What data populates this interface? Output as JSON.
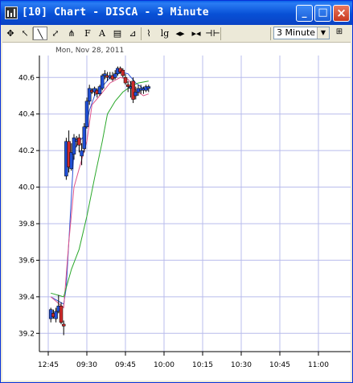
{
  "window": {
    "title": "[10] Chart - DISCA - 3 Minute",
    "minimize_label": "_",
    "maximize_label": "□",
    "close_label": "×"
  },
  "toolbar": {
    "tools": [
      {
        "name": "crosshair-tool",
        "glyph": "✥"
      },
      {
        "name": "pointer-tool",
        "glyph": "↖"
      },
      {
        "name": "trendline-tool",
        "glyph": "╲",
        "active": true
      },
      {
        "name": "angled-line-tool",
        "glyph": "⤢"
      },
      {
        "name": "pitchfork-tool",
        "glyph": "⋔"
      },
      {
        "name": "fibonacci-tool",
        "glyph": "F"
      },
      {
        "name": "text-tool",
        "glyph": "A"
      },
      {
        "name": "note-tool",
        "glyph": "▤"
      },
      {
        "name": "chart-style-tool",
        "glyph": "⊿"
      },
      {
        "name": "indicator-tool",
        "glyph": "⌇"
      },
      {
        "name": "log-scale-tool",
        "glyph": "lg"
      },
      {
        "name": "zoom-in-tool",
        "glyph": "◂▸"
      },
      {
        "name": "zoom-out-tool",
        "glyph": "▸◂"
      },
      {
        "name": "scroll-tool",
        "glyph": "⊣⊢"
      }
    ],
    "interval_value": "3 Minute",
    "interval_arrow": "▼",
    "extra_glyph": "⊞"
  },
  "chart_data": {
    "type": "candlestick",
    "symbol": "DISCA",
    "date_label": "Mon, Nov 28, 2011",
    "ylim": [
      39.1,
      40.72
    ],
    "y_ticks": [
      39.2,
      39.4,
      39.6,
      39.8,
      40.0,
      40.2,
      40.4,
      40.6
    ],
    "y_tick_labels": [
      "39.2",
      "39.4",
      "39.6",
      "39.8",
      "40.0",
      "40.2",
      "40.4",
      "40.6"
    ],
    "x_ticks": [
      0,
      15,
      30,
      45,
      60,
      75,
      90,
      105
    ],
    "x_tick_labels": [
      "12:45",
      "09:30",
      "09:45",
      "10:00",
      "10:15",
      "10:30",
      "10:45",
      "11:00"
    ],
    "grid": true,
    "up_color": "#1f4fd6",
    "down_color": "#cc2a2a",
    "grid_color": "#b8bcec",
    "candles": [
      {
        "t": 1,
        "o": 39.28,
        "h": 39.34,
        "l": 39.26,
        "c": 39.33
      },
      {
        "t": 2,
        "o": 39.31,
        "h": 39.33,
        "l": 39.28,
        "c": 39.29
      },
      {
        "t": 3,
        "o": 39.28,
        "h": 39.34,
        "l": 39.26,
        "c": 39.32
      },
      {
        "t": 4,
        "o": 39.32,
        "h": 39.41,
        "l": 39.31,
        "c": 39.35
      },
      {
        "t": 5,
        "o": 39.35,
        "h": 39.37,
        "l": 39.25,
        "c": 39.26
      },
      {
        "t": 6,
        "o": 39.25,
        "h": 39.27,
        "l": 39.19,
        "c": 39.24
      },
      {
        "t": 7,
        "o": 40.06,
        "h": 40.27,
        "l": 40.04,
        "c": 40.25
      },
      {
        "t": 8,
        "o": 40.25,
        "h": 40.31,
        "l": 40.08,
        "c": 40.11
      },
      {
        "t": 9,
        "o": 40.1,
        "h": 40.24,
        "l": 40.09,
        "c": 40.19
      },
      {
        "t": 10,
        "o": 40.18,
        "h": 40.29,
        "l": 40.15,
        "c": 40.27
      },
      {
        "t": 11,
        "o": 40.25,
        "h": 40.28,
        "l": 40.22,
        "c": 40.26
      },
      {
        "t": 12,
        "o": 40.27,
        "h": 40.29,
        "l": 40.19,
        "c": 40.23
      },
      {
        "t": 13,
        "o": 40.17,
        "h": 40.24,
        "l": 40.12,
        "c": 40.2
      },
      {
        "t": 14,
        "o": 40.21,
        "h": 40.35,
        "l": 40.19,
        "c": 40.33
      },
      {
        "t": 15,
        "o": 40.33,
        "h": 40.49,
        "l": 40.32,
        "c": 40.47
      },
      {
        "t": 16,
        "o": 40.47,
        "h": 40.56,
        "l": 40.45,
        "c": 40.54
      },
      {
        "t": 17,
        "o": 40.53,
        "h": 40.54,
        "l": 40.51,
        "c": 40.52
      },
      {
        "t": 18,
        "o": 40.52,
        "h": 40.55,
        "l": 40.5,
        "c": 40.54
      },
      {
        "t": 19,
        "o": 40.53,
        "h": 40.54,
        "l": 40.49,
        "c": 40.51
      },
      {
        "t": 20,
        "o": 40.51,
        "h": 40.56,
        "l": 40.5,
        "c": 40.55
      },
      {
        "t": 21,
        "o": 40.54,
        "h": 40.62,
        "l": 40.53,
        "c": 40.61
      },
      {
        "t": 22,
        "o": 40.61,
        "h": 40.64,
        "l": 40.59,
        "c": 40.62
      },
      {
        "t": 23,
        "o": 40.61,
        "h": 40.63,
        "l": 40.58,
        "c": 40.6
      },
      {
        "t": 24,
        "o": 40.6,
        "h": 40.63,
        "l": 40.59,
        "c": 40.61
      },
      {
        "t": 25,
        "o": 40.61,
        "h": 40.63,
        "l": 40.58,
        "c": 40.59
      },
      {
        "t": 26,
        "o": 40.6,
        "h": 40.64,
        "l": 40.59,
        "c": 40.62
      },
      {
        "t": 27,
        "o": 40.62,
        "h": 40.66,
        "l": 40.61,
        "c": 40.65
      },
      {
        "t": 28,
        "o": 40.65,
        "h": 40.66,
        "l": 40.62,
        "c": 40.63
      },
      {
        "t": 29,
        "o": 40.64,
        "h": 40.65,
        "l": 40.6,
        "c": 40.61
      },
      {
        "t": 30,
        "o": 40.6,
        "h": 40.62,
        "l": 40.56,
        "c": 40.57
      },
      {
        "t": 31,
        "o": 40.56,
        "h": 40.58,
        "l": 40.52,
        "c": 40.55
      },
      {
        "t": 32,
        "o": 40.54,
        "h": 40.58,
        "l": 40.49,
        "c": 40.55
      },
      {
        "t": 33,
        "o": 40.58,
        "h": 40.6,
        "l": 40.46,
        "c": 40.48
      },
      {
        "t": 34,
        "o": 40.5,
        "h": 40.55,
        "l": 40.48,
        "c": 40.52
      },
      {
        "t": 35,
        "o": 40.52,
        "h": 40.56,
        "l": 40.5,
        "c": 40.54
      },
      {
        "t": 36,
        "o": 40.53,
        "h": 40.56,
        "l": 40.51,
        "c": 40.54
      },
      {
        "t": 37,
        "o": 40.53,
        "h": 40.55,
        "l": 40.51,
        "c": 40.54
      },
      {
        "t": 38,
        "o": 40.53,
        "h": 40.56,
        "l": 40.52,
        "c": 40.55
      },
      {
        "t": 39,
        "o": 40.54,
        "h": 40.56,
        "l": 40.52,
        "c": 40.55
      }
    ],
    "series": [
      {
        "color": "#2e55d8",
        "values": [
          [
            1,
            39.4
          ],
          [
            6,
            39.36
          ],
          [
            7,
            39.45
          ],
          [
            10,
            40.2
          ],
          [
            12,
            40.25
          ],
          [
            14,
            40.28
          ],
          [
            16,
            40.42
          ],
          [
            18,
            40.5
          ],
          [
            21,
            40.55
          ],
          [
            24,
            40.6
          ],
          [
            28,
            40.63
          ],
          [
            31,
            40.62
          ],
          [
            34,
            40.57
          ],
          [
            37,
            40.54
          ],
          [
            39,
            40.53
          ]
        ]
      },
      {
        "color": "#e0558a",
        "values": [
          [
            1,
            39.4
          ],
          [
            6,
            39.34
          ],
          [
            8,
            39.7
          ],
          [
            10,
            40.0
          ],
          [
            13,
            40.15
          ],
          [
            15,
            40.25
          ],
          [
            17,
            40.45
          ],
          [
            20,
            40.5
          ],
          [
            24,
            40.57
          ],
          [
            28,
            40.6
          ],
          [
            31,
            40.59
          ],
          [
            34,
            40.53
          ],
          [
            37,
            40.5
          ],
          [
            39,
            40.51
          ]
        ]
      },
      {
        "color": "#2aa82a",
        "values": [
          [
            1,
            39.42
          ],
          [
            6,
            39.4
          ],
          [
            9,
            39.55
          ],
          [
            12,
            39.66
          ],
          [
            15,
            39.84
          ],
          [
            18,
            40.05
          ],
          [
            21,
            40.25
          ],
          [
            23,
            40.4
          ],
          [
            26,
            40.47
          ],
          [
            29,
            40.52
          ],
          [
            32,
            40.55
          ],
          [
            35,
            40.57
          ],
          [
            39,
            40.58
          ]
        ]
      }
    ]
  }
}
